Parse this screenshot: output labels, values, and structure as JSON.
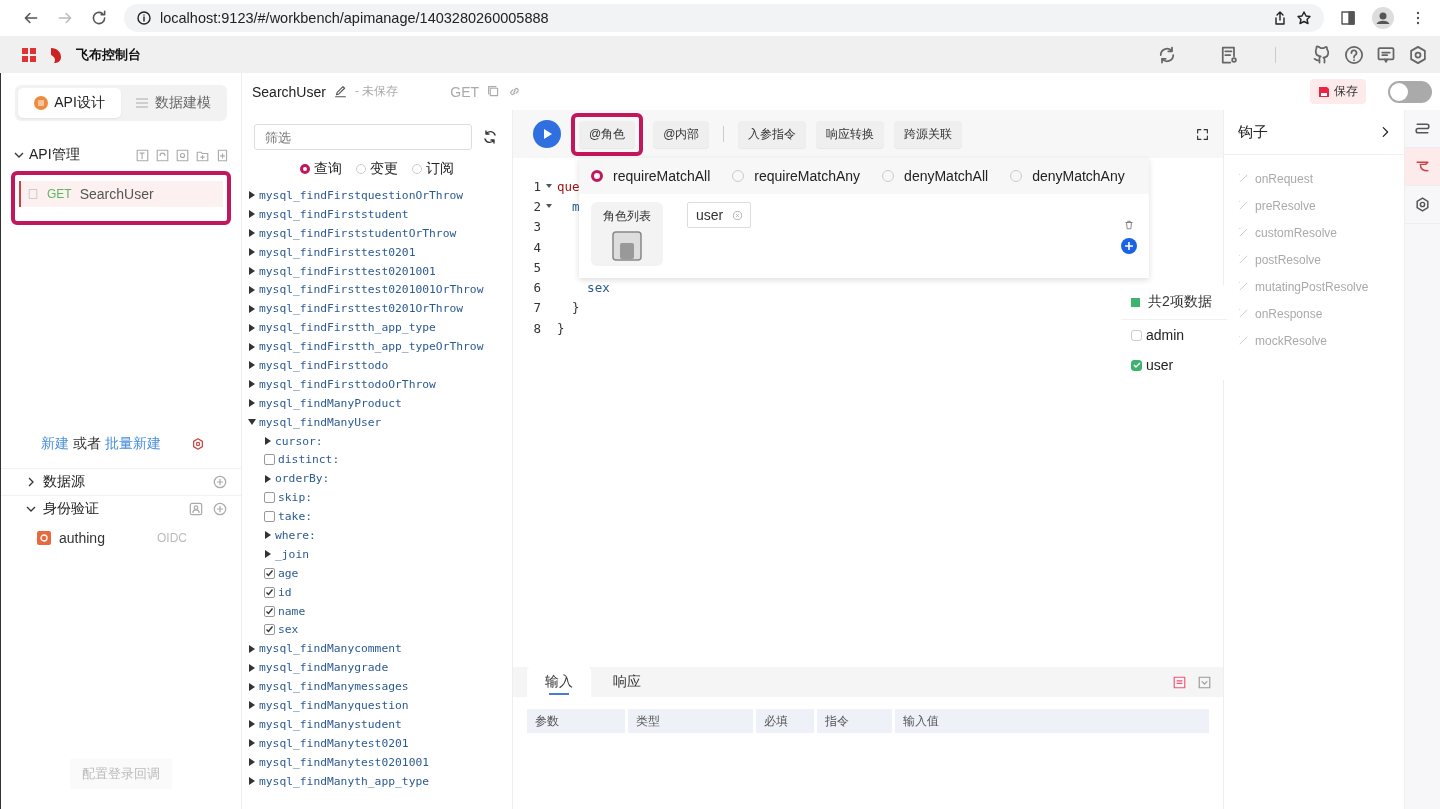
{
  "browser": {
    "url": "localhost:9123/#/workbench/apimanage/1403280260005888"
  },
  "app_header": {
    "title": "飞布控制台"
  },
  "sidebar": {
    "tabs": [
      {
        "label": "API设计",
        "selected": true
      },
      {
        "label": "数据建模",
        "selected": false
      }
    ],
    "api_section": {
      "title": "API管理",
      "expanded": true,
      "items": [
        {
          "method": "GET",
          "name": "SearchUser",
          "selected": true,
          "highlighted": true
        }
      ]
    },
    "create_links": {
      "new": "新建",
      "or": "或者",
      "batch": "批量新建"
    },
    "sections": [
      {
        "title": "数据源",
        "expanded": false
      },
      {
        "title": "身份验证",
        "expanded": true,
        "items": [
          {
            "name": "authing",
            "type": "OIDC"
          }
        ]
      }
    ],
    "footer_button": "配置登录回调"
  },
  "api_bar": {
    "name": "SearchUser",
    "status": "- 未保存",
    "method": "GET",
    "save_button": "保存",
    "toggle_on": false
  },
  "operation_tree": {
    "filter_placeholder": "筛选",
    "modes": [
      {
        "label": "查询",
        "selected": true
      },
      {
        "label": "变更",
        "selected": false
      },
      {
        "label": "订阅",
        "selected": false
      }
    ],
    "items": [
      {
        "kind": "node",
        "label": "mysql_findFirstquestionOrThrow",
        "expanded": false
      },
      {
        "kind": "node",
        "label": "mysql_findFirststudent",
        "expanded": false
      },
      {
        "kind": "node",
        "label": "mysql_findFirststudentOrThrow",
        "expanded": false
      },
      {
        "kind": "node",
        "label": "mysql_findFirsttest0201",
        "expanded": false
      },
      {
        "kind": "node",
        "label": "mysql_findFirsttest0201001",
        "expanded": false
      },
      {
        "kind": "node",
        "label": "mysql_findFirsttest0201001OrThrow",
        "expanded": false
      },
      {
        "kind": "node",
        "label": "mysql_findFirsttest0201OrThrow",
        "expanded": false
      },
      {
        "kind": "node",
        "label": "mysql_findFirstth_app_type",
        "expanded": false
      },
      {
        "kind": "node",
        "label": "mysql_findFirstth_app_typeOrThrow",
        "expanded": false
      },
      {
        "kind": "node",
        "label": "mysql_findFirsttodo",
        "expanded": false
      },
      {
        "kind": "node",
        "label": "mysql_findFirsttodoOrThrow",
        "expanded": false
      },
      {
        "kind": "node",
        "label": "mysql_findManyProduct",
        "expanded": false
      },
      {
        "kind": "node",
        "label": "mysql_findManyUser",
        "expanded": true,
        "children": [
          {
            "kind": "node",
            "label": "cursor:",
            "expanded": false
          },
          {
            "kind": "check",
            "label": "distinct:",
            "checked": false
          },
          {
            "kind": "node",
            "label": "orderBy:",
            "expanded": false
          },
          {
            "kind": "check",
            "label": "skip:",
            "checked": false
          },
          {
            "kind": "check",
            "label": "take:",
            "checked": false
          },
          {
            "kind": "node",
            "label": "where:",
            "expanded": false
          },
          {
            "kind": "node",
            "label": "_join",
            "expanded": false
          },
          {
            "kind": "check",
            "label": "age",
            "checked": true
          },
          {
            "kind": "check",
            "label": "id",
            "checked": true
          },
          {
            "kind": "check",
            "label": "name",
            "checked": true
          },
          {
            "kind": "check",
            "label": "sex",
            "checked": true
          }
        ]
      },
      {
        "kind": "node",
        "label": "mysql_findManycomment",
        "expanded": false
      },
      {
        "kind": "node",
        "label": "mysql_findManygrade",
        "expanded": false
      },
      {
        "kind": "node",
        "label": "mysql_findManymessages",
        "expanded": false
      },
      {
        "kind": "node",
        "label": "mysql_findManyquestion",
        "expanded": false
      },
      {
        "kind": "node",
        "label": "mysql_findManystudent",
        "expanded": false
      },
      {
        "kind": "node",
        "label": "mysql_findManytest0201",
        "expanded": false
      },
      {
        "kind": "node",
        "label": "mysql_findManytest0201001",
        "expanded": false
      },
      {
        "kind": "node",
        "label": "mysql_findManyth_app_type",
        "expanded": false
      }
    ]
  },
  "editor": {
    "toolbar": [
      {
        "label": "@角色",
        "highlighted": true
      },
      {
        "label": "@内部",
        "highlighted": false
      },
      {
        "label": "入参指令",
        "highlighted": false
      },
      {
        "label": "响应转换",
        "highlighted": false
      },
      {
        "label": "跨源关联",
        "highlighted": false
      }
    ],
    "code_lines": [
      {
        "number": "1",
        "fold": true,
        "text": "que",
        "kind": "keyword"
      },
      {
        "number": "2",
        "fold": true,
        "text": "  m",
        "kind": "field"
      },
      {
        "number": "3",
        "fold": false
      },
      {
        "number": "4",
        "fold": false
      },
      {
        "number": "5",
        "fold": false
      },
      {
        "number": "6",
        "fold": false,
        "text": "    sex",
        "kind": "field"
      },
      {
        "number": "7",
        "fold": false,
        "text": "  }",
        "kind": "punct"
      },
      {
        "number": "8",
        "fold": false,
        "text": "}",
        "kind": "punct"
      }
    ]
  },
  "role_popup": {
    "modes": [
      {
        "label": "requireMatchAll",
        "selected": true
      },
      {
        "label": "requireMatchAny",
        "selected": false
      },
      {
        "label": "denyMatchAll",
        "selected": false
      },
      {
        "label": "denyMatchAny",
        "selected": false
      }
    ],
    "list_label": "角色列表",
    "tags": [
      "user"
    ]
  },
  "role_dropdown": {
    "summary": "共2项数据",
    "options": [
      {
        "label": "admin",
        "checked": false
      },
      {
        "label": "user",
        "checked": true
      }
    ]
  },
  "bottom_panel": {
    "tabs": [
      {
        "label": "输入",
        "selected": true
      },
      {
        "label": "响应",
        "selected": false
      }
    ],
    "columns": [
      "参数",
      "类型",
      "必填",
      "指令",
      "输入值"
    ]
  },
  "hooks": {
    "title": "钩子",
    "items": [
      "onRequest",
      "preResolve",
      "customResolve",
      "postResolve",
      "mutatingPostResolve",
      "onResponse",
      "mockResolve"
    ]
  },
  "right_strip": {
    "items": [
      {
        "kind": "flow",
        "selected": false
      },
      {
        "kind": "hook",
        "selected": true
      },
      {
        "kind": "settings",
        "selected": false
      }
    ]
  }
}
